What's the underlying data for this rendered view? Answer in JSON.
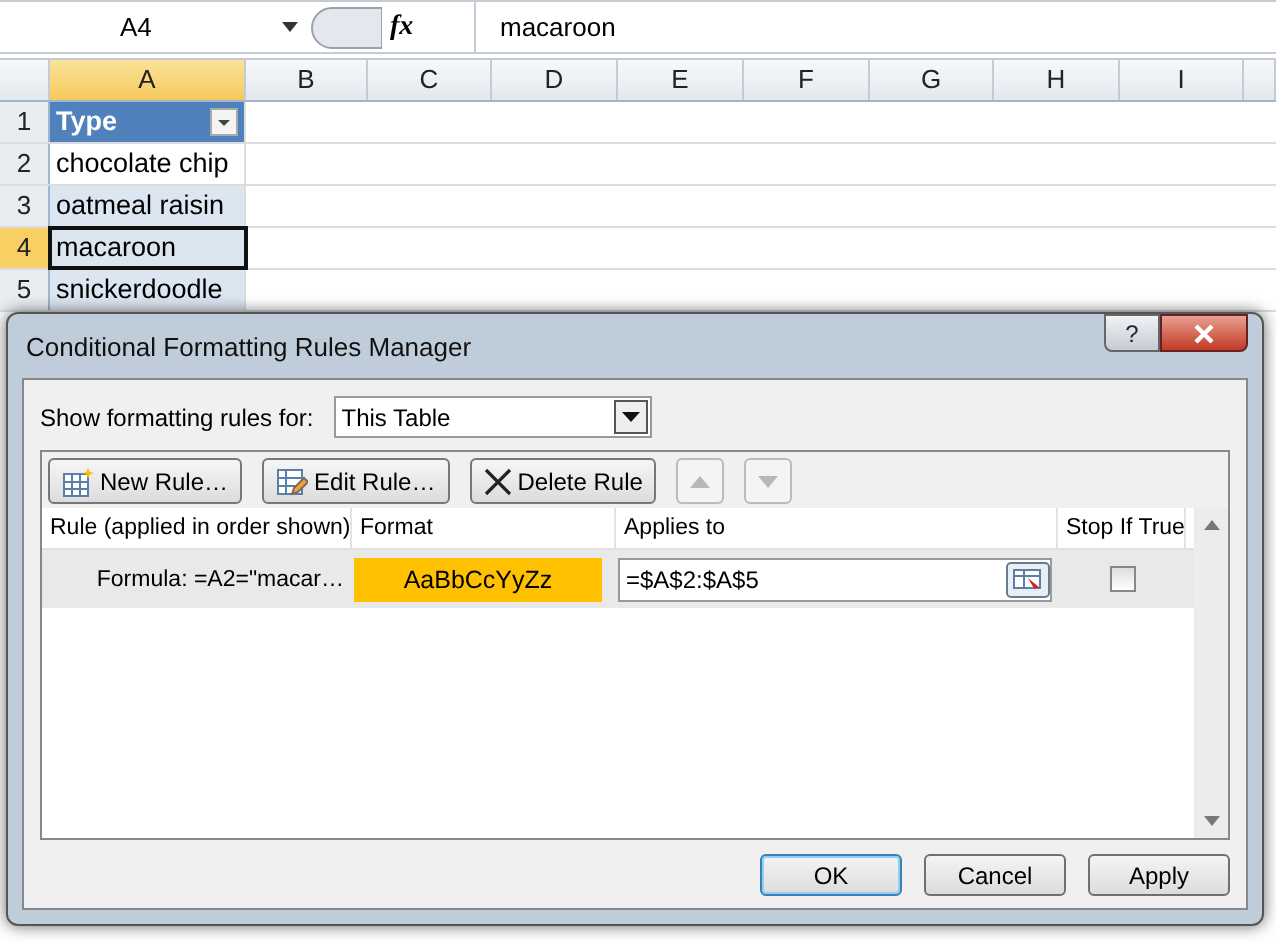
{
  "formula_bar": {
    "name_box": "A4",
    "fx": "fx",
    "value": "macaroon"
  },
  "sheet": {
    "columns": [
      {
        "label": "A",
        "selected": true
      },
      {
        "label": "B",
        "selected": false
      },
      {
        "label": "C",
        "selected": false
      },
      {
        "label": "D",
        "selected": false
      },
      {
        "label": "E",
        "selected": false
      },
      {
        "label": "F",
        "selected": false
      },
      {
        "label": "G",
        "selected": false
      },
      {
        "label": "H",
        "selected": false
      },
      {
        "label": "I",
        "selected": false
      }
    ],
    "rows": [
      {
        "number": "1",
        "cell": "Type",
        "kind": "header",
        "selected": false
      },
      {
        "number": "2",
        "cell": "chocolate chip",
        "kind": "data",
        "selected": false
      },
      {
        "number": "3",
        "cell": "oatmeal raisin",
        "kind": "data",
        "selected": false
      },
      {
        "number": "4",
        "cell": "macaroon",
        "kind": "data",
        "selected": true
      },
      {
        "number": "5",
        "cell": "snickerdoodle",
        "kind": "data",
        "selected": false
      }
    ]
  },
  "dialog": {
    "title": "Conditional Formatting Rules Manager",
    "help": "?",
    "show_label": "Show formatting rules for:",
    "scope": "This Table",
    "buttons": [
      {
        "label": "New Rule…",
        "kind": "new"
      },
      {
        "label": "Edit Rule…",
        "kind": "edit"
      },
      {
        "label": "Delete Rule",
        "kind": "delete"
      }
    ],
    "move_up": {
      "disabled": true
    },
    "move_down": {
      "disabled": true
    },
    "columns": [
      "Rule (applied in order shown)",
      "Format",
      "Applies to",
      "Stop If True"
    ],
    "rules": [
      {
        "rule": "Formula: =A2=\"macar…",
        "preview": "AaBbCcYyZz",
        "color": "#ffc000",
        "applies_to": "=$A$2:$A$5",
        "stop_if_true": false,
        "selected": true
      }
    ],
    "footer": [
      {
        "label": "OK",
        "default": true
      },
      {
        "label": "Cancel",
        "default": false
      },
      {
        "label": "Apply",
        "default": false
      }
    ]
  }
}
